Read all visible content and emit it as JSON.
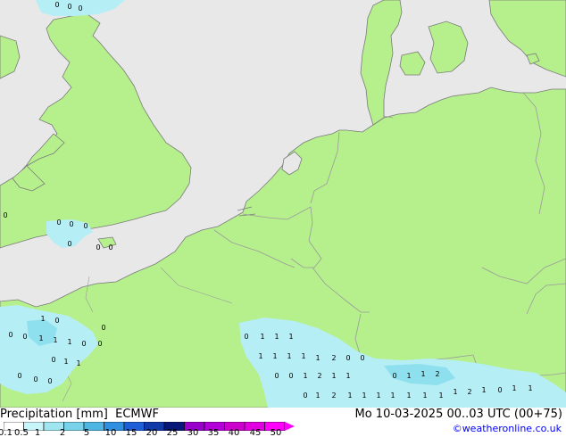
{
  "title": {
    "variable": "Precipitation [mm]",
    "model": "ECMWF",
    "valid_time": "Mo 10-03-2025 00..03 UTC (00+75)"
  },
  "credit": "©weatheronline.co.uk",
  "colors": {
    "sea": "#e8e8e8",
    "land": "#b6f08c",
    "border": "#a0a0a0",
    "coast": "#7a7a7a",
    "precip_light": "#b6eef6",
    "precip_mid": "#8fe0ee",
    "credit": "#0000ff"
  },
  "legend": {
    "ticks": [
      "0.1",
      "0.5",
      "1",
      "2",
      "5",
      "10",
      "15",
      "20",
      "25",
      "30",
      "35",
      "40",
      "45",
      "50"
    ],
    "swatches": [
      "#ffffff",
      "#c8f5fa",
      "#a0e6f0",
      "#78d2ea",
      "#4fb6e4",
      "#2f8fe0",
      "#1e5fd8",
      "#0f3aa8",
      "#081878",
      "#9900cc",
      "#b400d8",
      "#cc00cc",
      "#e000e0",
      "#ff00ff"
    ]
  },
  "precip_values": [
    "0",
    "0",
    "0",
    "0",
    "0",
    "0",
    "0",
    "0",
    "0",
    "0",
    "0",
    "1",
    "0",
    "0",
    "0",
    "1",
    "1",
    "1",
    "0",
    "0",
    "0",
    "1",
    "1",
    "0",
    "0",
    "0",
    "0",
    "1",
    "1",
    "1",
    "1",
    "1",
    "1",
    "1",
    "1",
    "2",
    "0",
    "0",
    "0",
    "0",
    "1",
    "2",
    "1",
    "1",
    "0",
    "1",
    "2",
    "1",
    "1",
    "1",
    "1",
    "1",
    "1",
    "1",
    "1",
    "2",
    "1",
    "0",
    "1",
    "1",
    "0",
    "1",
    "1",
    "2",
    "2"
  ]
}
